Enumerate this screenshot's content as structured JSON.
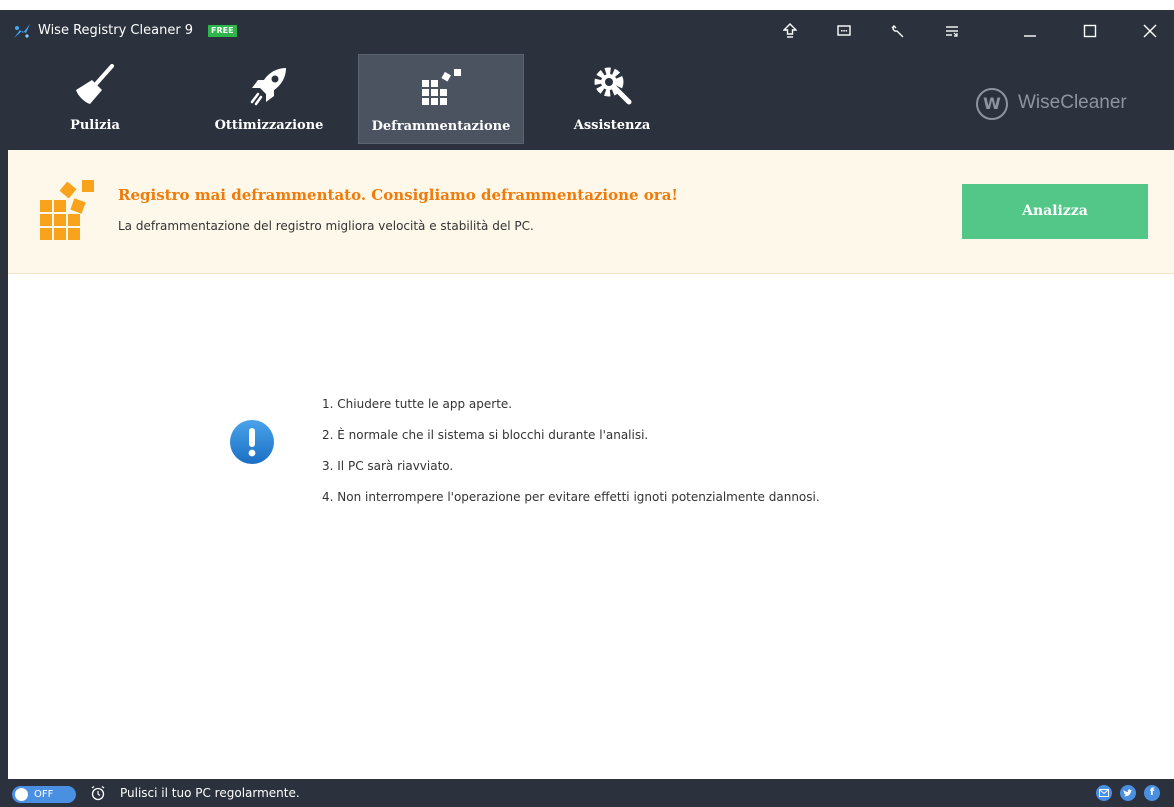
{
  "window": {
    "title": "Wise Registry Cleaner 9",
    "badge": "FREE"
  },
  "titlebar_buttons": [
    "upgrade-icon",
    "feedback-icon",
    "tools-icon",
    "menu-icon",
    "minimize-icon",
    "maximize-icon",
    "close-icon"
  ],
  "nav": {
    "tabs": [
      {
        "label": "Pulizia",
        "icon": "broom-icon",
        "active": false
      },
      {
        "label": "Ottimizzazione",
        "icon": "rocket-icon",
        "active": false
      },
      {
        "label": "Deframmentazione",
        "icon": "defrag-icon",
        "active": true
      },
      {
        "label": "Assistenza",
        "icon": "gear-wrench-icon",
        "active": false
      }
    ],
    "brand": "WiseCleaner",
    "brand_logo": "W"
  },
  "banner": {
    "title": "Registro mai deframmentato. Consigliamo deframmentazione ora!",
    "subtitle": "La deframmentazione del registro migliora velocità e stabilità del PC.",
    "button": "Analizza",
    "title_color": "#f07b0a",
    "button_color": "#52c787"
  },
  "main": {
    "steps": [
      "1. Chiudere tutte le app aperte.",
      "2. È normale che il sistema si blocchi durante l'analisi.",
      "3. Il PC sarà riavviato.",
      "4. Non interrompere l'operazione per evitare effetti ignoti potenzialmente dannosi."
    ]
  },
  "statusbar": {
    "toggle_label": "OFF",
    "text": "Pulisci il tuo PC regolarmente.",
    "social": [
      "email-icon",
      "twitter-icon",
      "facebook-icon"
    ]
  },
  "colors": {
    "dark": "#2b323d",
    "active_tab": "#4b5361",
    "accent_blue": "#4a90e2"
  }
}
